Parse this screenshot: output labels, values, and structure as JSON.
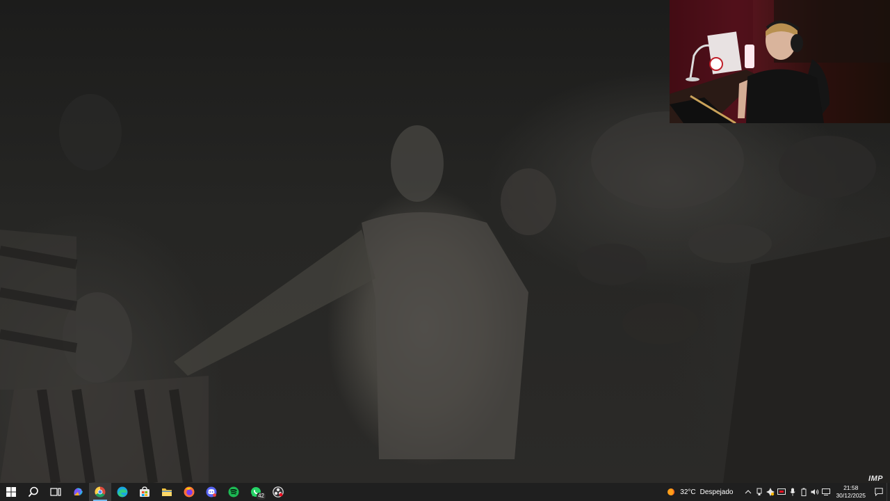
{
  "watermark": {
    "text": "IMP"
  },
  "taskbar": {
    "start_icon": "windows-start-icon",
    "pinned": [
      {
        "name": "search",
        "icon": "search-icon"
      },
      {
        "name": "task-view",
        "icon": "task-view-icon"
      },
      {
        "name": "copilot",
        "icon": "copilot-icon",
        "color": "#7a5af8"
      },
      {
        "name": "chrome",
        "icon": "chrome-icon",
        "color": "#dd4b3e",
        "active": true
      },
      {
        "name": "edge",
        "icon": "edge-icon",
        "color": "#1aa7e0"
      },
      {
        "name": "microsoft-store",
        "icon": "store-icon",
        "color": "#0078d4"
      },
      {
        "name": "file-explorer",
        "icon": "folder-icon",
        "color": "#f2c341"
      },
      {
        "name": "firefox",
        "icon": "firefox-icon",
        "color": "#ff7139"
      },
      {
        "name": "discord",
        "icon": "discord-icon",
        "color": "#5865f2"
      },
      {
        "name": "spotify",
        "icon": "spotify-icon",
        "color": "#1db954"
      },
      {
        "name": "whatsapp",
        "icon": "whatsapp-icon",
        "color": "#25d366",
        "badge": "42"
      },
      {
        "name": "obs",
        "icon": "obs-icon",
        "color": "#302e31"
      }
    ],
    "weather": {
      "temperature": "32°C",
      "condition": "Despejado",
      "icon": "sun-weather-icon"
    },
    "tray": {
      "chevron_icon": "chevron-up-icon",
      "icons": [
        "usb-icon",
        "colorful-app-icon",
        "display-icon",
        "microphone-icon",
        "battery-icon",
        "speaker-icon",
        "network-icon"
      ]
    },
    "clock": {
      "time": "21:58",
      "date": "30/12/2025"
    },
    "notification_icon": "notification-icon"
  },
  "colors": {
    "taskbar_bg": "#1f1f1f",
    "active_indicator": "#76b9ed"
  }
}
